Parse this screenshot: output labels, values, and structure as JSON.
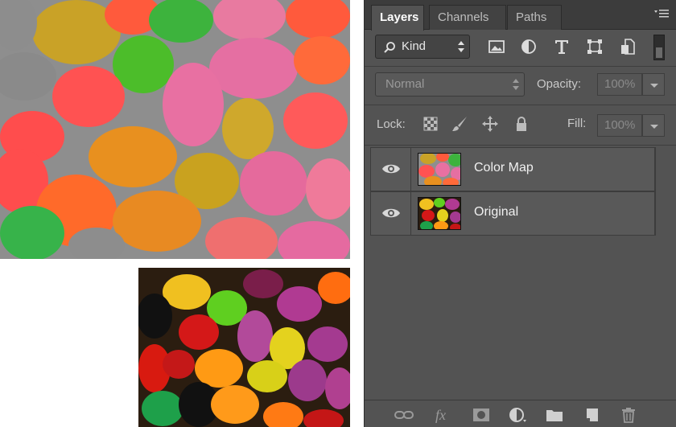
{
  "panel": {
    "tabs": [
      {
        "label": "Layers",
        "active": true
      },
      {
        "label": "Channels",
        "active": false
      },
      {
        "label": "Paths",
        "active": false
      }
    ],
    "menu_icon": "panel-menu-icon"
  },
  "filter": {
    "kind_label": "Kind",
    "icons": [
      "image-filter-icon",
      "adjustment-filter-icon",
      "type-filter-icon",
      "shape-filter-icon",
      "smart-object-filter-icon"
    ]
  },
  "blend": {
    "mode": "Normal",
    "opacity_label": "Opacity:",
    "opacity_value": "100%"
  },
  "lock": {
    "label": "Lock:",
    "fill_label": "Fill:",
    "fill_value": "100%",
    "icons": [
      "lock-transparent-pixels-icon",
      "lock-image-pixels-icon",
      "lock-position-icon",
      "lock-all-icon"
    ]
  },
  "layers": [
    {
      "name": "Color Map",
      "visible": true
    },
    {
      "name": "Original",
      "visible": true
    }
  ],
  "bottom_icons": [
    "link-layers-icon",
    "fx-icon",
    "mask-icon",
    "adjustment-layer-icon",
    "group-folder-icon",
    "new-layer-icon",
    "trash-icon"
  ],
  "colors": {
    "panel_bg": "#535353",
    "tab_bar": "#3c3c3c",
    "layer_row": "#595959"
  }
}
